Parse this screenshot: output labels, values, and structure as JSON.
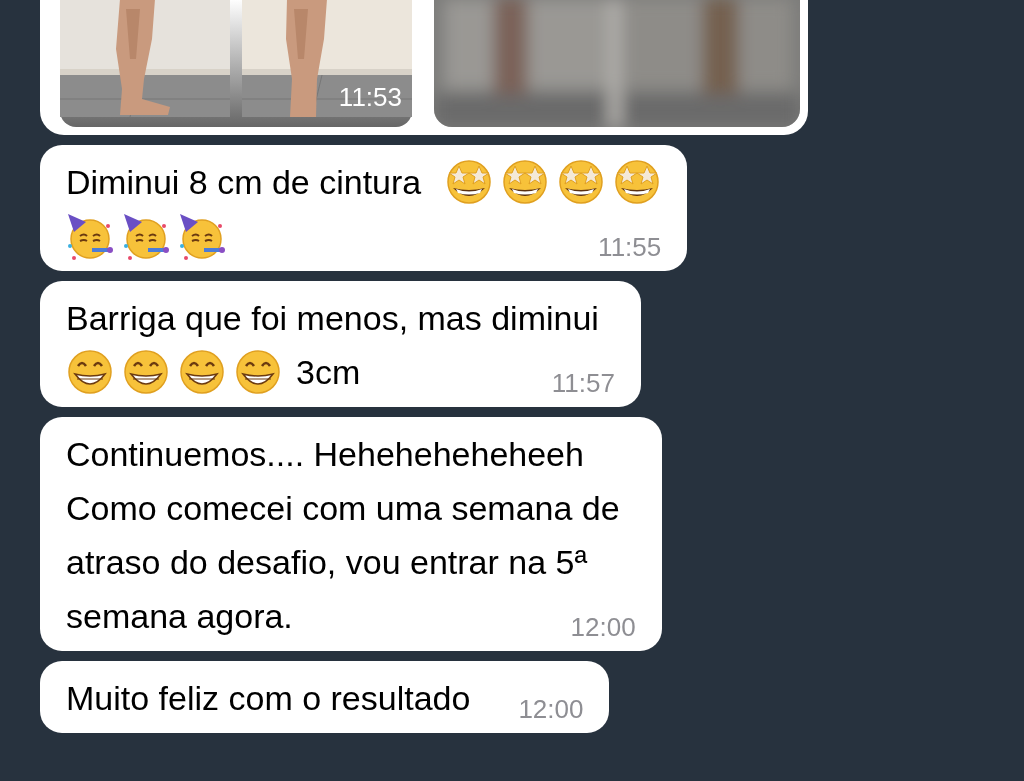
{
  "messages": [
    {
      "kind": "photos",
      "time": "11:53"
    },
    {
      "kind": "text",
      "lines": [
        [
          {
            "kind": "text",
            "text": "Diminui 8 cm de cintura"
          },
          {
            "kind": "star-struck"
          },
          {
            "kind": "star-struck"
          },
          {
            "kind": "star-struck"
          },
          {
            "kind": "star-struck"
          }
        ],
        [
          {
            "kind": "party"
          },
          {
            "kind": "party"
          },
          {
            "kind": "party"
          }
        ]
      ],
      "time": "11:55"
    },
    {
      "kind": "text",
      "lines": [
        [
          {
            "kind": "text",
            "text": "Barriga que foi menos, mas diminui"
          }
        ],
        [
          {
            "kind": "grin"
          },
          {
            "kind": "grin"
          },
          {
            "kind": "grin"
          },
          {
            "kind": "grin"
          },
          {
            "kind": "text",
            "text": "3cm"
          }
        ]
      ],
      "time": "11:57"
    },
    {
      "kind": "text",
      "lines": [
        [
          {
            "kind": "text",
            "text": "Continuemos.... Heheheheheheeh"
          }
        ],
        [
          {
            "kind": "text",
            "text": "Como comecei com uma semana de"
          }
        ],
        [
          {
            "kind": "text",
            "text": "atraso do desafio, vou entrar na 5ª"
          }
        ],
        [
          {
            "kind": "text",
            "text": "semana agora."
          }
        ]
      ],
      "time": "12:00"
    },
    {
      "kind": "text",
      "lines": [
        [
          {
            "kind": "text",
            "text": "Muito feliz com o resultado"
          }
        ]
      ],
      "time": "12:00"
    }
  ]
}
